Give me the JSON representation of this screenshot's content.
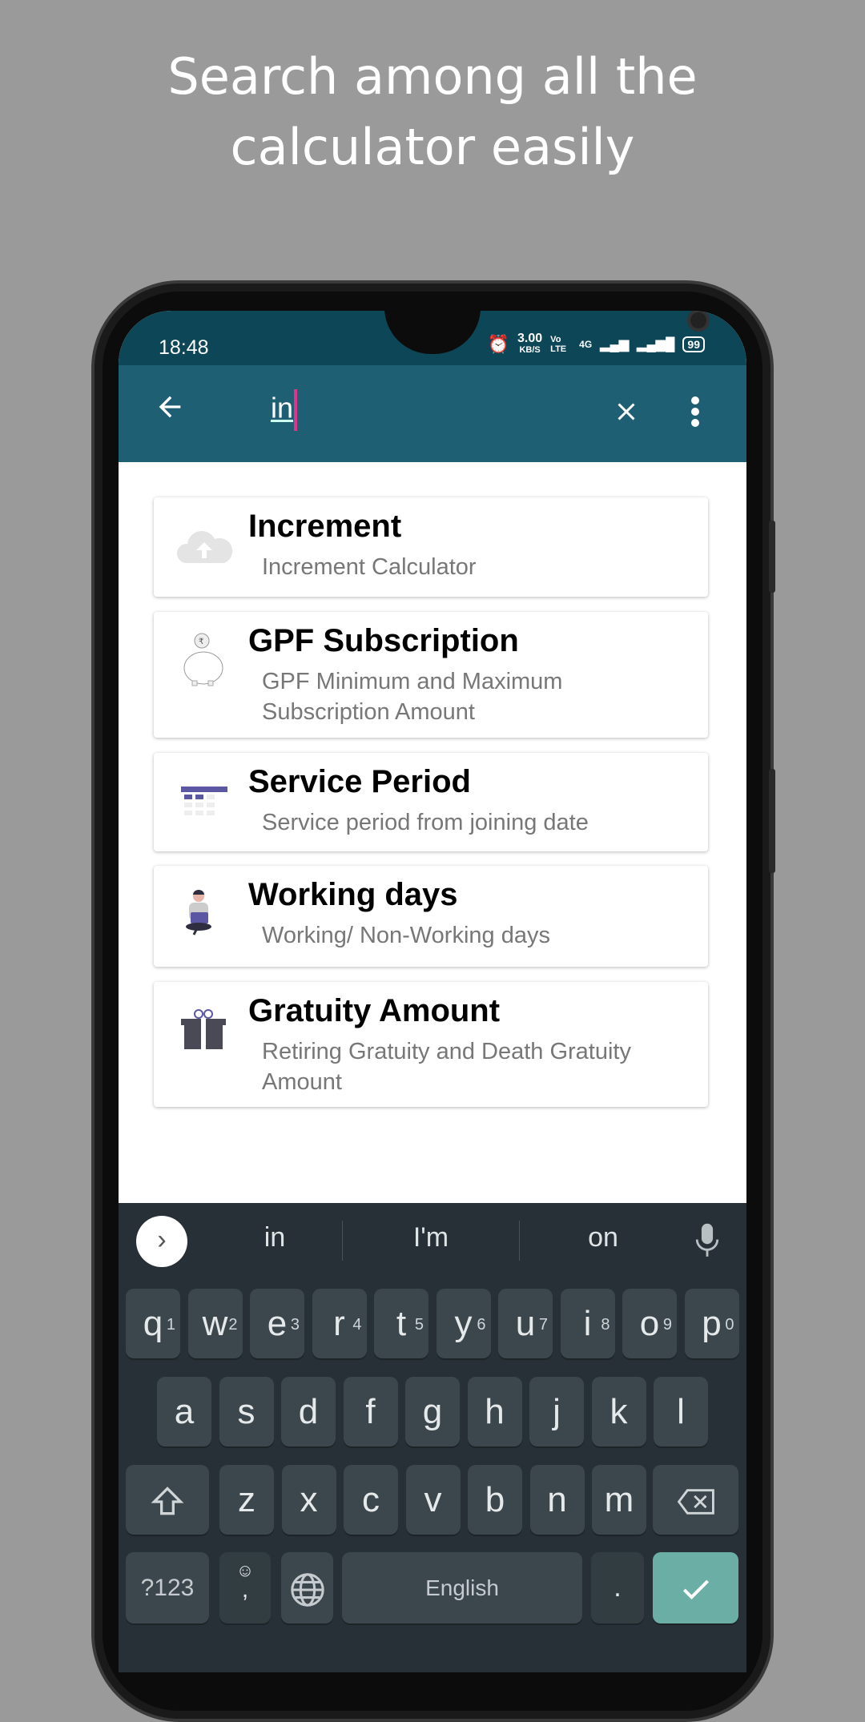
{
  "headline": [
    "Search among all the",
    "calculator easily"
  ],
  "status": {
    "time": "18:48",
    "speed": "3.00",
    "speed_unit": "KB/S",
    "volte": "Vo LTE",
    "network": "4G",
    "battery": "99"
  },
  "toolbar": {
    "query": "in",
    "back_icon": "arrow-left-icon",
    "clear_icon": "close-icon",
    "menu_icon": "more-vert-icon",
    "color": "#1f5f74"
  },
  "results": [
    {
      "title": "Increment",
      "subtitle": "Increment Calculator",
      "icon": "cloud-upload-icon"
    },
    {
      "title": "GPF Subscription",
      "subtitle": "GPF Minimum and Maximum Subscription Amount",
      "icon": "piggy-bank-icon"
    },
    {
      "title": "Service Period",
      "subtitle": "Service period from joining date",
      "icon": "calendar-icon"
    },
    {
      "title": "Working days",
      "subtitle": "Working/ Non-Working days",
      "icon": "person-laptop-icon"
    },
    {
      "title": "Gratuity Amount",
      "subtitle": "Retiring Gratuity and Death Gratuity Amount",
      "icon": "gift-icon"
    }
  ],
  "keyboard": {
    "suggestions": [
      "in",
      "I'm",
      "on"
    ],
    "row1": [
      "q",
      "w",
      "e",
      "r",
      "t",
      "y",
      "u",
      "i",
      "o",
      "p"
    ],
    "row1_hints": [
      "1",
      "2",
      "3",
      "4",
      "5",
      "6",
      "7",
      "8",
      "9",
      "0"
    ],
    "row2": [
      "a",
      "s",
      "d",
      "f",
      "g",
      "h",
      "j",
      "k",
      "l"
    ],
    "row3": [
      "z",
      "x",
      "c",
      "v",
      "b",
      "n",
      "m"
    ],
    "symbols": "?123",
    "comma": ",",
    "space": "English",
    "period": ".",
    "enter_color": "#6aaea6"
  }
}
